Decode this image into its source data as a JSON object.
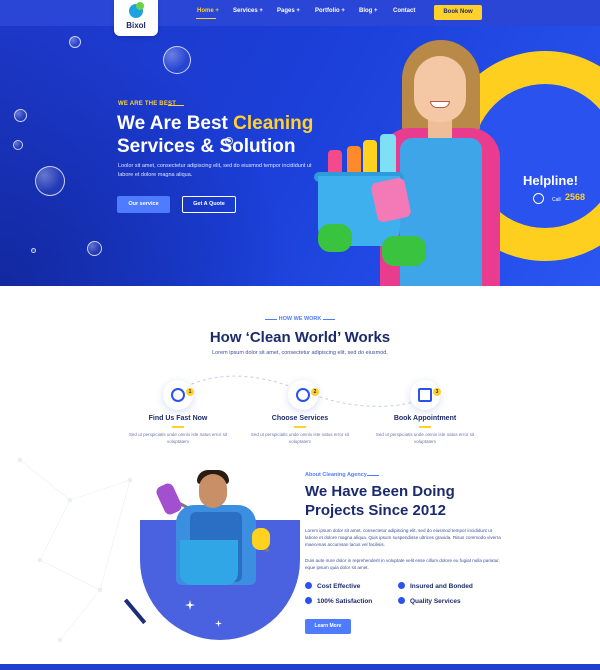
{
  "brand": {
    "name": "Bixol"
  },
  "nav": {
    "items": [
      {
        "label": "Home +"
      },
      {
        "label": "Services +"
      },
      {
        "label": "Pages +"
      },
      {
        "label": "Portfolio +"
      },
      {
        "label": "Blog +"
      },
      {
        "label": "Contact"
      }
    ],
    "cta": "Book Now"
  },
  "hero": {
    "kicker": "WE ARE THE BEST",
    "title_part1": "We Are Best ",
    "title_highlight": "Cleaning",
    "title_part2": "Services & Solution",
    "subtitle": "Loolor sit amet, consectetur adipiscing elit, sed do eiusmod tempor incididunt ut labore et dolore magna aliqua.",
    "primary_button": "Our service",
    "secondary_button": "Get A Quote",
    "helpline_label": "Helpline!",
    "call_label": "Call",
    "call_number": "2568"
  },
  "how": {
    "kicker": "HOW WE WORK",
    "title": "How ‘Clean World’ Works",
    "subtitle": "Lorem ipsum dolor sit amet, consectetur adipiscing elit, sed do eiusmod.",
    "steps": [
      {
        "num": "1",
        "title": "Find Us Fast Now",
        "desc": "Sed ut perspiciatis unde omnis iste natus error sit voluptatem"
      },
      {
        "num": "2",
        "title": "Choose Services",
        "desc": "Sed ut perspiciatis unde omnis iste natus error sit voluptatem"
      },
      {
        "num": "3",
        "title": "Book Appointment",
        "desc": "Sed ut perspiciatis unde omnis iste natus error sit voluptatem"
      }
    ]
  },
  "about": {
    "kicker": "About Cleaning Agency",
    "title_line1": "We Have Been Doing",
    "title_line2": "Projects Since 2012",
    "para1": "Lorem ipsum dolor sit amet, consectetur adipiscing elit, sed do eiusmod tempor incididunt ut labore et dolore magna aliqua. Quis ipsum suspendisse ultrices gravida. Risus commodo viverra maecenas accumsan lacus vel facilisis.",
    "para2": "Duis aute irure dolor in reprehenderit in voluptate velit esse cillum dolore eu fugiat nulla pariatur. eque ipsum quia dolor sit amet.",
    "features": [
      "Cost Effective",
      "Insured and Bonded",
      "100% Satisfaction",
      "Quality Services"
    ],
    "button": "Learn More"
  }
}
